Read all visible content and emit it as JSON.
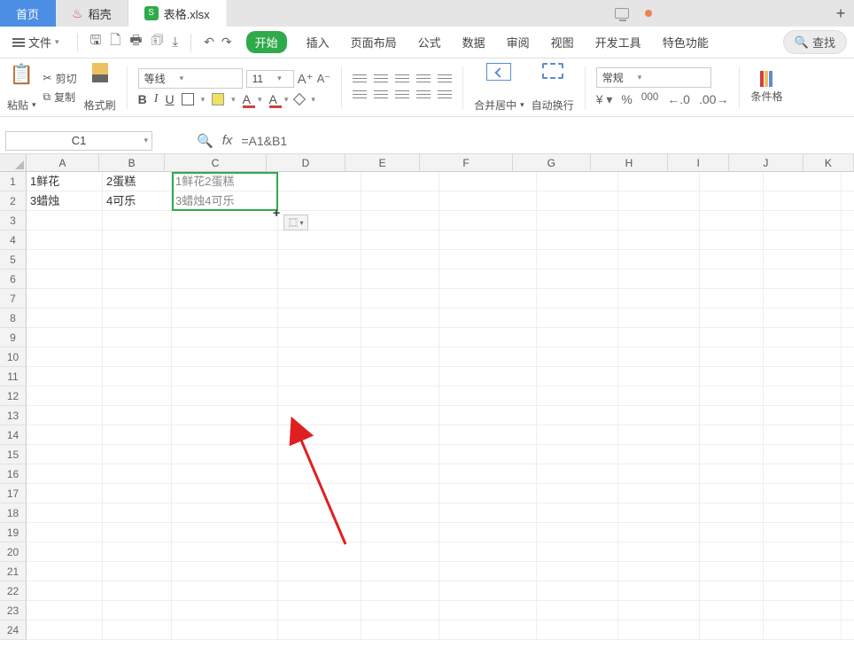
{
  "tabs": {
    "home": "首页",
    "daoke": "稻壳",
    "file": "表格.xlsx"
  },
  "menu": {
    "file_label": "文件",
    "start": "开始",
    "insert": "插入",
    "page_layout": "页面布局",
    "formula": "公式",
    "data": "数据",
    "review": "审阅",
    "view": "视图",
    "dev": "开发工具",
    "special": "特色功能",
    "search": "查找"
  },
  "ribbon": {
    "paste": "粘贴",
    "cut": "剪切",
    "copy": "复制",
    "format_painter": "格式刷",
    "font_name": "等线",
    "font_size": "11",
    "merge": "合并居中",
    "wrap": "自动换行",
    "number_format": "常规",
    "cond_fmt": "条件格"
  },
  "formula_bar": {
    "name_box": "C1",
    "formula": "=A1&B1"
  },
  "columns": [
    "A",
    "B",
    "C",
    "D",
    "E",
    "F",
    "G",
    "H",
    "I",
    "J",
    "K"
  ],
  "rows": [
    "1",
    "2",
    "3",
    "4",
    "5",
    "6",
    "7",
    "8",
    "9",
    "10",
    "11",
    "12",
    "13",
    "14",
    "15",
    "16",
    "17",
    "18",
    "19",
    "20",
    "21",
    "22",
    "23",
    "24"
  ],
  "cells": {
    "A1": "1鲜花",
    "B1": "2蛋糕",
    "C1": "1鲜花2蛋糕",
    "A2": "3蜡烛",
    "B2": "4可乐",
    "C2": "3蜡烛4可乐"
  }
}
